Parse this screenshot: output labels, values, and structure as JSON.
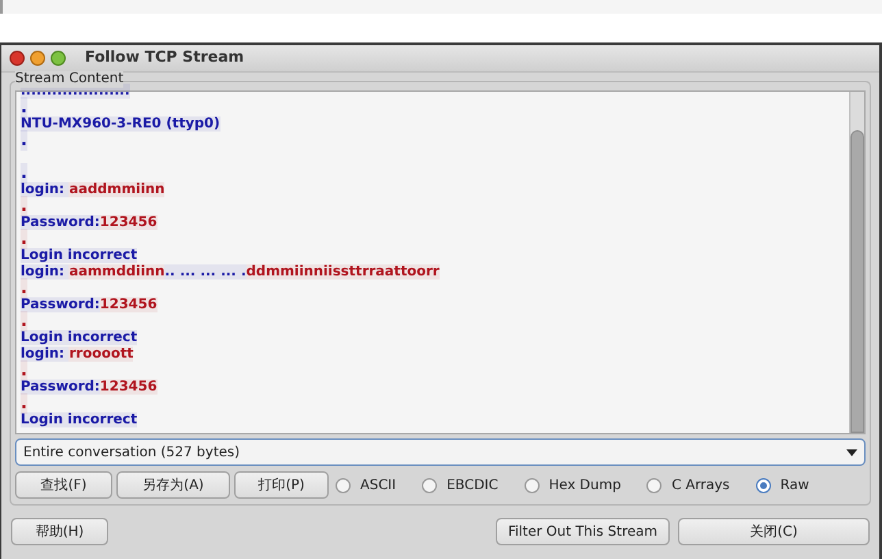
{
  "window": {
    "title": "Follow TCP Stream"
  },
  "stream_content": {
    "label": "Stream Content",
    "lines": [
      {
        "kind": "text",
        "segments": [
          {
            "color": "#1a1aa6",
            "text": "....................."
          }
        ]
      },
      {
        "kind": "text",
        "segments": [
          {
            "color": "#1a1aa6",
            "text": "."
          }
        ]
      },
      {
        "kind": "text",
        "segments": [
          {
            "color": "#1a1aa6",
            "text": "NTU-MX960-3-RE0 (ttyp0)"
          }
        ]
      },
      {
        "kind": "text",
        "segments": [
          {
            "color": "#1a1aa6",
            "text": "."
          }
        ]
      },
      {
        "kind": "blank"
      },
      {
        "kind": "text",
        "segments": [
          {
            "color": "#1a1aa6",
            "text": "."
          }
        ]
      },
      {
        "kind": "text",
        "segments": [
          {
            "color": "#1a1aa6",
            "text": "login: "
          },
          {
            "color": "#b0141e",
            "text": "aaddmmiinn"
          }
        ]
      },
      {
        "kind": "text",
        "segments": [
          {
            "color": "#b0141e",
            "text": "."
          }
        ]
      },
      {
        "kind": "text",
        "segments": [
          {
            "color": "#1a1aa6",
            "text": "Password:"
          },
          {
            "color": "#b0141e",
            "text": "123456"
          }
        ]
      },
      {
        "kind": "text",
        "segments": [
          {
            "color": "#b0141e",
            "text": "."
          }
        ]
      },
      {
        "kind": "text",
        "segments": [
          {
            "color": "#1a1aa6",
            "text": "Login incorrect"
          }
        ]
      },
      {
        "kind": "text",
        "segments": [
          {
            "color": "#1a1aa6",
            "text": "login: "
          },
          {
            "color": "#b0141e",
            "text": "aammddiinn"
          },
          {
            "color": "#1a1aa6",
            "text": ".. ... ... ... ."
          },
          {
            "color": "#b0141e",
            "text": "ddmmiinniissttrraattoorr"
          }
        ]
      },
      {
        "kind": "text",
        "segments": [
          {
            "color": "#b0141e",
            "text": "."
          }
        ]
      },
      {
        "kind": "text",
        "segments": [
          {
            "color": "#1a1aa6",
            "text": "Password:"
          },
          {
            "color": "#b0141e",
            "text": "123456"
          }
        ]
      },
      {
        "kind": "text",
        "segments": [
          {
            "color": "#b0141e",
            "text": "."
          }
        ]
      },
      {
        "kind": "text",
        "segments": [
          {
            "color": "#1a1aa6",
            "text": "Login incorrect"
          }
        ]
      },
      {
        "kind": "text",
        "segments": [
          {
            "color": "#1a1aa6",
            "text": "login: "
          },
          {
            "color": "#b0141e",
            "text": "rroooott"
          }
        ]
      },
      {
        "kind": "text",
        "segments": [
          {
            "color": "#b0141e",
            "text": "."
          }
        ]
      },
      {
        "kind": "text",
        "segments": [
          {
            "color": "#1a1aa6",
            "text": "Password:"
          },
          {
            "color": "#b0141e",
            "text": "123456"
          }
        ]
      },
      {
        "kind": "text",
        "segments": [
          {
            "color": "#b0141e",
            "text": "."
          }
        ]
      },
      {
        "kind": "text",
        "segments": [
          {
            "color": "#1a1aa6",
            "text": "Login incorrect"
          }
        ]
      }
    ]
  },
  "conversation_dropdown": {
    "value": "Entire conversation (527 bytes)"
  },
  "action_buttons": [
    "查找(F)",
    "另存为(A)",
    "打印(P)"
  ],
  "formats": [
    {
      "label": "ASCII",
      "selected": false
    },
    {
      "label": "EBCDIC",
      "selected": false
    },
    {
      "label": "Hex Dump",
      "selected": false
    },
    {
      "label": "C Arrays",
      "selected": false
    },
    {
      "label": "Raw",
      "selected": true
    }
  ],
  "help_button": "帮助(H)",
  "filter_button": "Filter Out This Stream",
  "close_button": "关闭(C)"
}
